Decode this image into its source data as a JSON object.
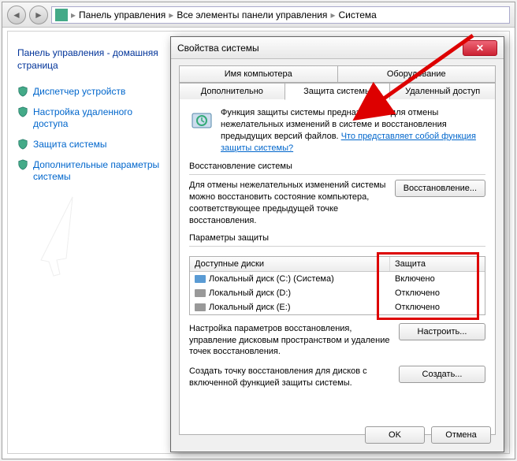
{
  "breadcrumbs": [
    "Панель управления",
    "Все элементы панели управления",
    "Система"
  ],
  "leftnav": {
    "title": "Панель управления - домашняя страница",
    "items": [
      "Диспетчер устройств",
      "Настройка удаленного доступа",
      "Защита системы",
      "Дополнительные параметры системы"
    ]
  },
  "dialog": {
    "title": "Свойства системы",
    "tabs": {
      "row1": [
        "Имя компьютера",
        "Оборудование"
      ],
      "row2": [
        "Дополнительно",
        "Защита системы",
        "Удаленный доступ"
      ],
      "active": "Защита системы"
    },
    "info_text": "Функция защиты системы предназначена для отмены нежелательных изменений в системе и восстановления предыдущих версий файлов. ",
    "info_link": "Что представляет собой функция защиты системы?",
    "restore": {
      "label": "Восстановление системы",
      "text": "Для отмены нежелательных изменений системы можно восстановить состояние компьютера, соответствующее предыдущей точке восстановления.",
      "button": "Восстановление..."
    },
    "protection": {
      "label": "Параметры защиты",
      "col_disks": "Доступные диски",
      "col_status": "Защита",
      "disks": [
        {
          "name": "Локальный диск (C:) (Система)",
          "status": "Включено",
          "sys": true
        },
        {
          "name": "Локальный диск (D:)",
          "status": "Отключено",
          "sys": false
        },
        {
          "name": "Локальный диск (E:)",
          "status": "Отключено",
          "sys": false
        }
      ],
      "config_text": "Настройка параметров восстановления, управление дисковым пространством и удаление точек восстановления.",
      "config_button": "Настроить...",
      "create_text": "Создать точку восстановления для дисков с включенной функцией защиты системы.",
      "create_button": "Создать..."
    },
    "buttons": {
      "ok": "OK",
      "cancel": "Отмена"
    }
  }
}
